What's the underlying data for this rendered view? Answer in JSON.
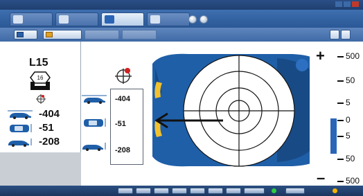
{
  "window": {
    "title": ""
  },
  "tabs": [
    {
      "label": ""
    },
    {
      "label": ""
    },
    {
      "label": ""
    },
    {
      "label": ""
    }
  ],
  "left_panel": {
    "wheel_label": "L15",
    "bolt_number": "16",
    "rows": [
      {
        "icon": "car-side-arrows-icon",
        "value": "-404"
      },
      {
        "icon": "car-top-icon",
        "value": "-51"
      },
      {
        "icon": "car-side-height-icon",
        "value": "-208"
      }
    ]
  },
  "center": {
    "values": [
      "-404",
      "-51",
      "-208"
    ],
    "accent_color": "#1f5fa8",
    "taillight_color": "#f2c12e"
  },
  "scale": {
    "plus": "+",
    "minus": "–",
    "ticks": [
      "500",
      "50",
      "5",
      "0",
      "5",
      "50",
      "500"
    ],
    "level_bar_color": "#2a66b8"
  },
  "status": {
    "text": ""
  }
}
